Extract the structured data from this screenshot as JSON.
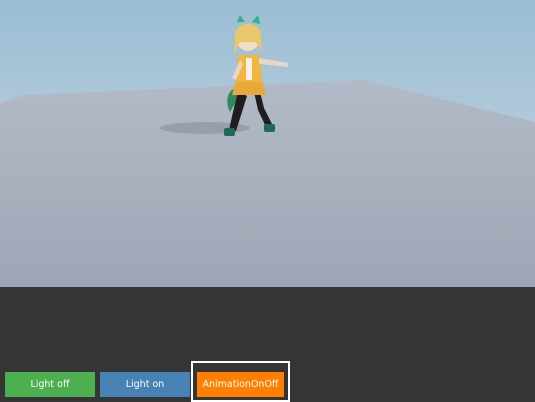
{
  "scene": {
    "sky_top_color": "#9fc0d6",
    "sky_bottom_color": "#c8d6e2",
    "floor_color": "#a9b1c0",
    "character": "anime-girl-3d-model"
  },
  "controls": {
    "light_off_label": "Light off",
    "light_on_label": "Light on",
    "animation_toggle_label": "AnimationOnOff",
    "colors": {
      "light_off": "#4caf50",
      "light_on": "#4682b4",
      "animation_toggle": "#ff7f00"
    }
  }
}
